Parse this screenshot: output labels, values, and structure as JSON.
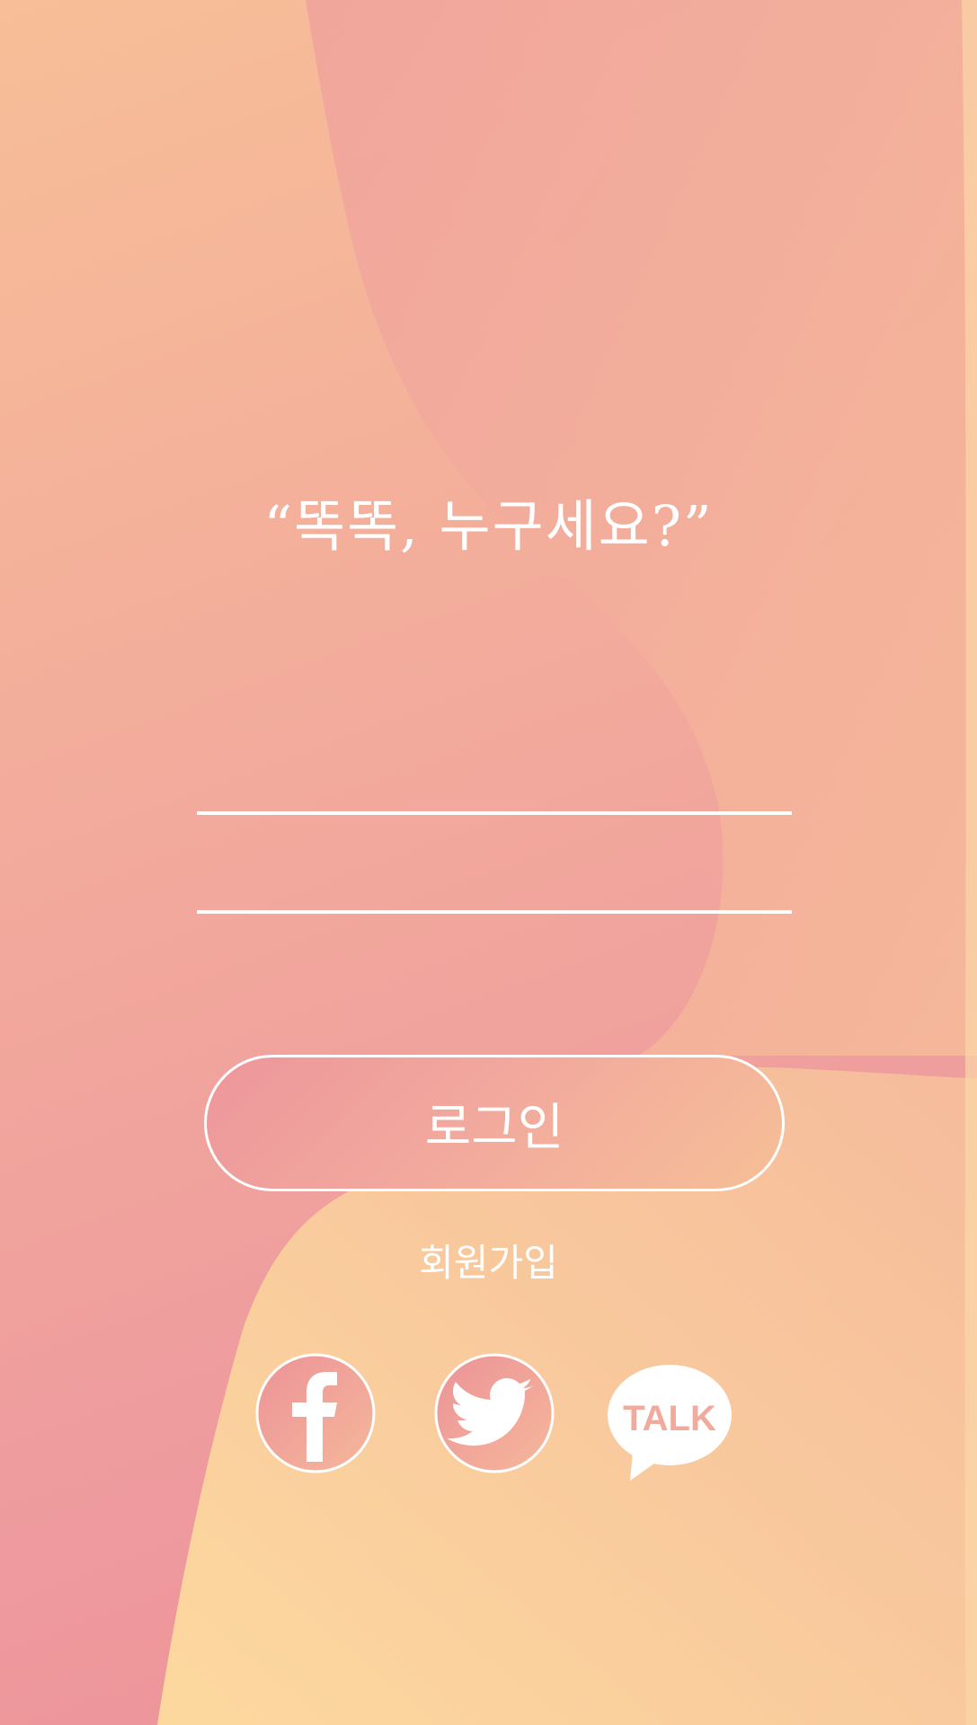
{
  "screen": {
    "title": "“똑똑, 누구세요?”",
    "login_button_label": "로그인",
    "signup_link_label": "회원가입",
    "id_field": {
      "value": "",
      "placeholder": ""
    },
    "password_field": {
      "value": "",
      "placeholder": ""
    }
  },
  "social_login": [
    {
      "name": "facebook",
      "icon": "facebook-icon"
    },
    {
      "name": "twitter",
      "icon": "twitter-icon"
    },
    {
      "name": "kakaotalk",
      "icon": "kakaotalk-icon",
      "label": "TALK"
    }
  ],
  "colors": {
    "background_top": "#f7be97",
    "background_bottom": "#ec9298",
    "accent_peach": "#fcd69f",
    "accent_pink": "#ec909b",
    "foreground": "#ffffff"
  }
}
